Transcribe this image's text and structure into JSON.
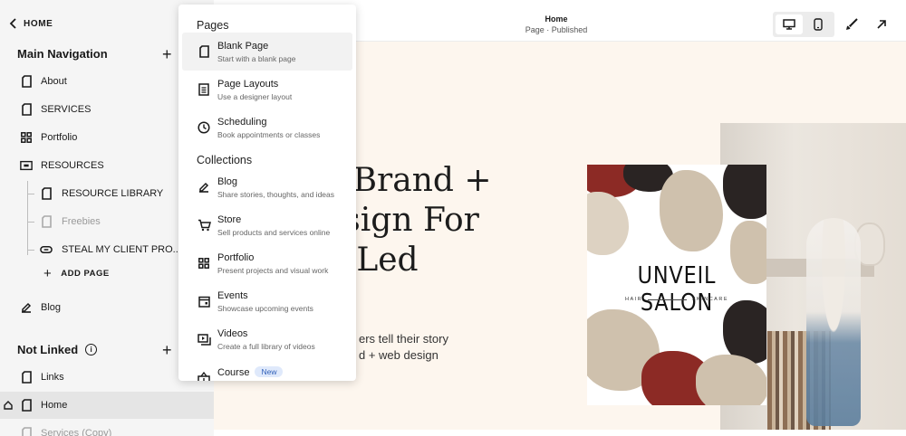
{
  "sidebar": {
    "home_label": "HOME",
    "main_nav_title": "Main Navigation",
    "main_items": [
      {
        "label": "About",
        "icon": "page-icon"
      },
      {
        "label": "SERVICES",
        "icon": "page-icon"
      },
      {
        "label": "Portfolio",
        "icon": "grid-icon"
      },
      {
        "label": "RESOURCES",
        "icon": "folder-icon"
      }
    ],
    "sub_items": [
      {
        "label": "RESOURCE LIBRARY",
        "icon": "page-icon"
      },
      {
        "label": "Freebies",
        "icon": "page-icon"
      },
      {
        "label": "STEAL MY CLIENT PRO...",
        "icon": "link-icon"
      }
    ],
    "add_page_label": "ADD PAGE",
    "blog_label": "Blog",
    "not_linked_title": "Not Linked",
    "not_linked_items": [
      {
        "label": "Links"
      },
      {
        "label": "Home"
      },
      {
        "label": "Services (Copy)"
      }
    ]
  },
  "topbar": {
    "title": "Home",
    "status": "Page · Published"
  },
  "preview": {
    "hero_lines": [
      "c Brand +",
      "esign For",
      "n-Led"
    ],
    "sub_lines": [
      "ers tell their story",
      "d + web design"
    ],
    "card_title": "UNVEIL SALON",
    "card_tag_left": "HAIR",
    "card_tag_right": "SKINCARE"
  },
  "dropdown": {
    "pages_heading": "Pages",
    "collections_heading": "Collections",
    "pages": [
      {
        "title": "Blank Page",
        "subtitle": "Start with a blank page"
      },
      {
        "title": "Page Layouts",
        "subtitle": "Use a designer layout"
      },
      {
        "title": "Scheduling",
        "subtitle": "Book appointments or classes"
      }
    ],
    "collections": [
      {
        "title": "Blog",
        "subtitle": "Share stories, thoughts, and ideas"
      },
      {
        "title": "Store",
        "subtitle": "Sell products and services online"
      },
      {
        "title": "Portfolio",
        "subtitle": "Present projects and visual work"
      },
      {
        "title": "Events",
        "subtitle": "Showcase upcoming events"
      },
      {
        "title": "Videos",
        "subtitle": "Create a full library of videos"
      },
      {
        "title": "Course",
        "badge": "New"
      }
    ]
  },
  "colors": {
    "canvas_bg": "#fdf6ee",
    "sidebar_bg": "#f5f5f5",
    "badge_bg": "#dfe9fb",
    "badge_text": "#2f5fb8",
    "blot_red": "#8c2a25",
    "blot_beige": "#cfc1ad"
  }
}
